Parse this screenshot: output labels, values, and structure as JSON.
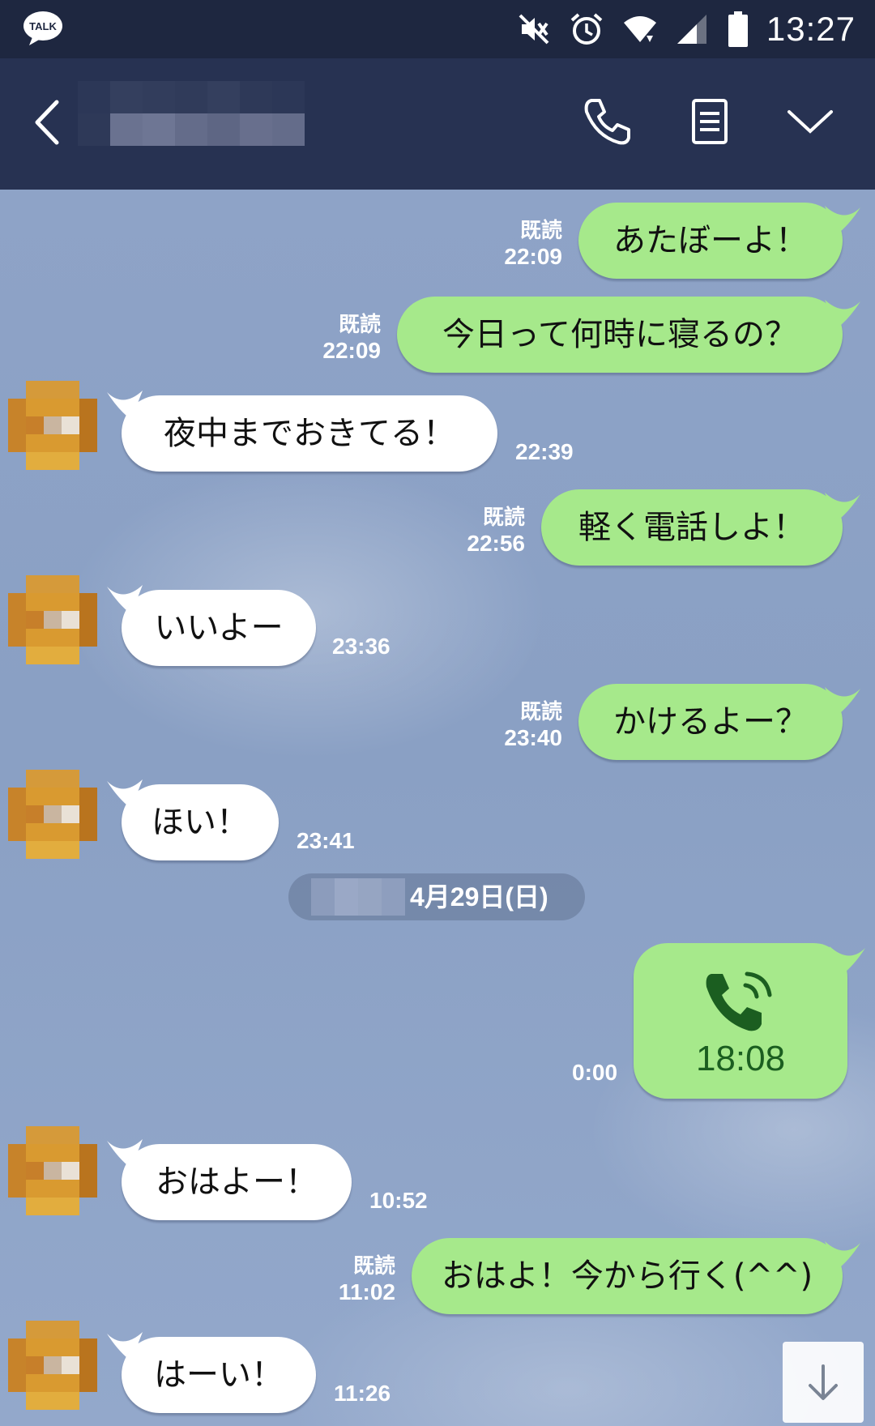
{
  "status_bar": {
    "app_badge": "TALK",
    "clock": "13:27"
  },
  "header": {
    "contact_name_hidden": true
  },
  "messages": [
    {
      "dir": "out",
      "text": "あたぼーよ！",
      "read": "既読",
      "time": "22:09"
    },
    {
      "dir": "out",
      "text": "今日って何時に寝るの？",
      "read": "既読",
      "time": "22:09"
    },
    {
      "dir": "in",
      "text": "夜中までおきてる！",
      "time": "22:39"
    },
    {
      "dir": "out",
      "text": "軽く電話しよ！",
      "read": "既読",
      "time": "22:56"
    },
    {
      "dir": "in",
      "text": "いいよー",
      "time": "23:36"
    },
    {
      "dir": "out",
      "text": "かけるよー？",
      "read": "既読",
      "time": "23:40"
    },
    {
      "dir": "in",
      "text": "ほい！",
      "time": "23:41"
    },
    {
      "dir": "in",
      "text": "おはよー！",
      "time": "10:52"
    },
    {
      "dir": "out",
      "text": "おはよ！今から行く(^^)",
      "read": "既読",
      "time": "11:02"
    },
    {
      "dir": "in",
      "text": "はーい！",
      "time": "11:26"
    }
  ],
  "date_separator": "4月29日(日)",
  "call": {
    "duration": "18:08",
    "time": "0:00"
  },
  "colors": {
    "header": "#273252",
    "status_bar": "#1e2740",
    "outgoing_bubble": "#a6e98b",
    "incoming_bubble": "#ffffff",
    "call_icon": "#1b5e20"
  },
  "icons": [
    "back-icon",
    "phone-icon",
    "notes-icon",
    "chevron-down-icon",
    "call-icon",
    "arrow-down-icon"
  ]
}
